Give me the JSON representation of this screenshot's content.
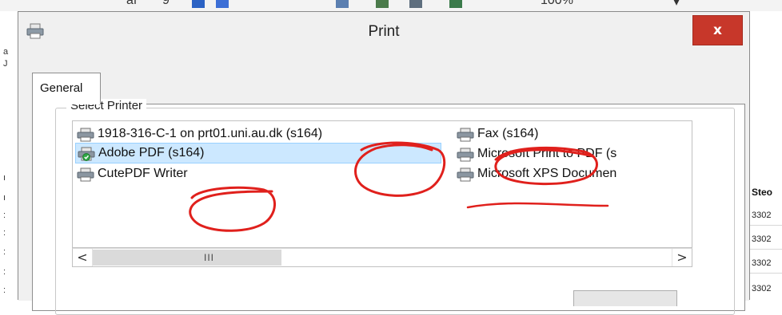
{
  "background": {
    "toolbar": {
      "items": [
        "af",
        "9",
        "100%",
        "▾"
      ]
    },
    "sheet": {
      "column_header": "Steo",
      "cells": [
        "3302",
        "3302",
        "3302",
        "3302"
      ]
    }
  },
  "dialog": {
    "title": "Print",
    "close_label": "x",
    "tabs": [
      {
        "label": "General"
      }
    ],
    "select_printer_label": "Select Printer",
    "printers": [
      {
        "name": "1918-316-C-1 on prt01.uni.au.dk (s164)",
        "icon": "printer-icon"
      },
      {
        "name": "Adobe PDF (s164)",
        "icon": "printer-default-icon",
        "selected": true
      },
      {
        "name": "CutePDF Writer",
        "icon": "printer-icon"
      },
      {
        "name": "Fax (s164)",
        "icon": "fax-icon"
      },
      {
        "name": "Microsoft Print to PDF (s",
        "icon": "printer-icon"
      },
      {
        "name": "Microsoft XPS Documen",
        "icon": "printer-icon"
      }
    ],
    "scrollbar": {
      "left_arrow": "<",
      "right_arrow": ">",
      "thumb_grip": "III"
    }
  },
  "colors": {
    "selection": "#cce8ff",
    "close_button": "#c7372a",
    "annotation": "#e0201c"
  }
}
